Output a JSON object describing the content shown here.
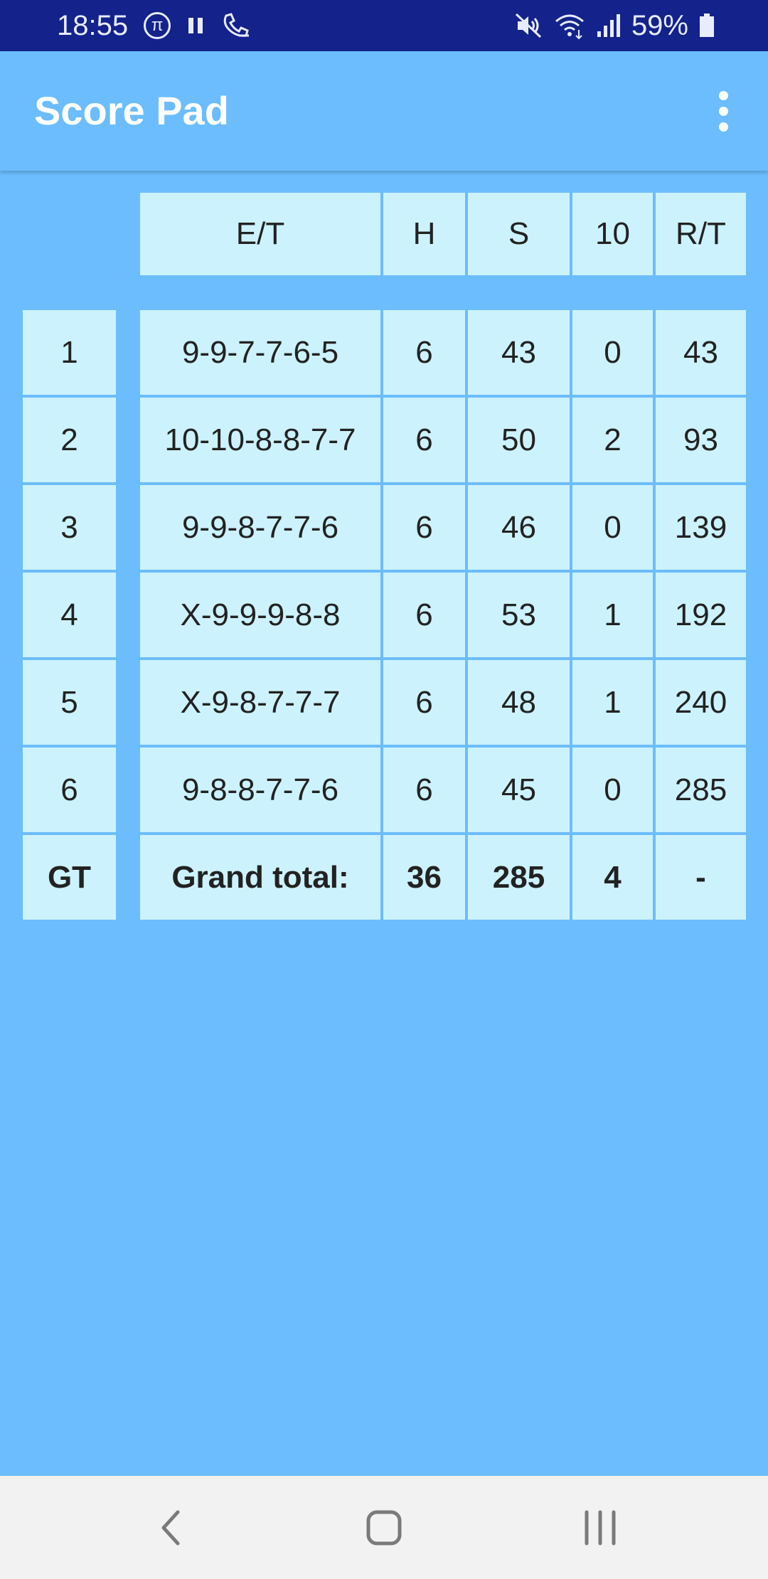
{
  "status_bar": {
    "time": "18:55",
    "battery": "59%",
    "icons": [
      "pi-icon",
      "pause-icon",
      "phone-call-icon",
      "mute-icon",
      "wifi-icon",
      "signal-icon",
      "battery-icon"
    ]
  },
  "app_bar": {
    "title": "Score Pad",
    "menu_icon": "more-vert-icon"
  },
  "table": {
    "headers": [
      "E/T",
      "H",
      "S",
      "10",
      "R/T"
    ],
    "rows": [
      {
        "index": "1",
        "et": "9-9-7-7-6-5",
        "h": "6",
        "s": "43",
        "ten": "0",
        "rt": "43"
      },
      {
        "index": "2",
        "et": "10-10-8-8-7-7",
        "h": "6",
        "s": "50",
        "ten": "2",
        "rt": "93"
      },
      {
        "index": "3",
        "et": "9-9-8-7-7-6",
        "h": "6",
        "s": "46",
        "ten": "0",
        "rt": "139"
      },
      {
        "index": "4",
        "et": "X-9-9-9-8-8",
        "h": "6",
        "s": "53",
        "ten": "1",
        "rt": "192"
      },
      {
        "index": "5",
        "et": "X-9-8-7-7-7",
        "h": "6",
        "s": "48",
        "ten": "1",
        "rt": "240"
      },
      {
        "index": "6",
        "et": "9-8-8-7-7-6",
        "h": "6",
        "s": "45",
        "ten": "0",
        "rt": "285"
      }
    ],
    "total": {
      "index": "GT",
      "et": "Grand total:",
      "h": "36",
      "s": "285",
      "ten": "4",
      "rt": "-"
    }
  },
  "nav_bar": {
    "icons": [
      "back-icon",
      "home-icon",
      "recents-icon"
    ]
  },
  "colors": {
    "status_bar": "#14228c",
    "background": "#6bbdfd",
    "cell": "#ccf2fd",
    "nav_bar": "#f2f2f2"
  }
}
